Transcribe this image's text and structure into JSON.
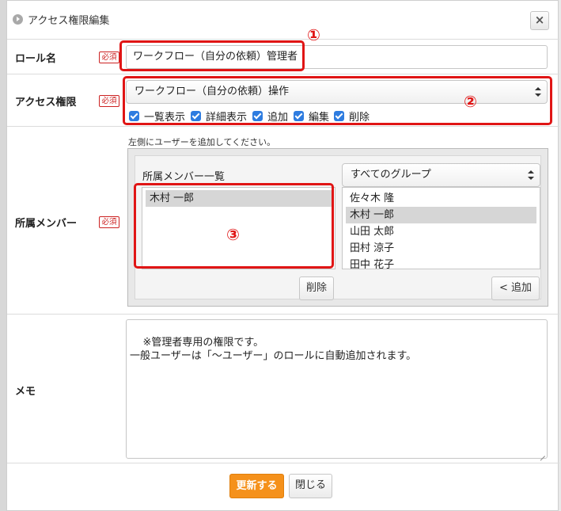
{
  "dialog": {
    "title": "アクセス権限編集",
    "close_label": "×"
  },
  "role_name": {
    "label": "ロール名",
    "required": "必須",
    "value": "ワークフロー（自分の依頼）管理者"
  },
  "access": {
    "label": "アクセス権限",
    "required": "必須",
    "selected": "ワークフロー（自分の依頼）操作",
    "permissions": [
      {
        "label": "一覧表示",
        "checked": true
      },
      {
        "label": "詳細表示",
        "checked": true
      },
      {
        "label": "追加",
        "checked": true
      },
      {
        "label": "編集",
        "checked": true
      },
      {
        "label": "削除",
        "checked": true
      }
    ]
  },
  "members": {
    "label": "所属メンバー",
    "required": "必須",
    "hint": "左側にユーザーを追加してください。",
    "list_title": "所属メンバー一覧",
    "group_select": "すべてのグループ",
    "assigned": [
      "木村 一郎"
    ],
    "available": [
      "佐々木 隆",
      "木村 一郎",
      "山田 太郎",
      "田村 涼子",
      "田中 花子"
    ],
    "available_selected_index": 1,
    "remove_label": "削除",
    "add_label": "< 追加"
  },
  "memo": {
    "label": "メモ",
    "value": "※管理者専用の権限です。\n一般ユーザーは「～ユーザー」のロールに自動追加されます。"
  },
  "footer": {
    "update_label": "更新する",
    "close_label": "閉じる"
  },
  "annotations": [
    "①",
    "②",
    "③"
  ],
  "colors": {
    "accent": "#f5911b",
    "highlight": "#e01515",
    "checkbox": "#2e7ce0"
  }
}
